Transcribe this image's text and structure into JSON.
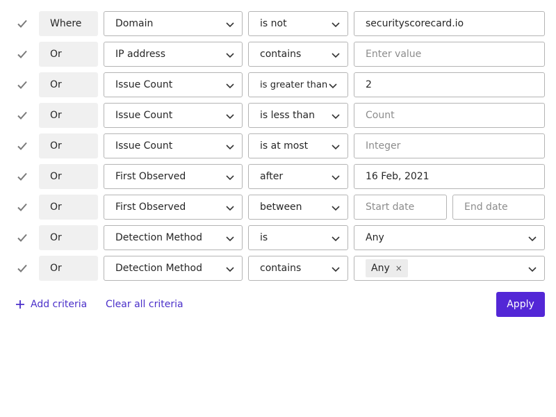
{
  "colors": {
    "accent": "#5327d6",
    "link": "#4a2fc9",
    "check": "#7a7a7a",
    "conjunction_bg": "#f0f0f0",
    "border": "#b4b4b4"
  },
  "criteria": [
    {
      "conjunction": "Where",
      "field": "Domain",
      "operator": "is not",
      "value": "securityscorecard.io",
      "placeholder": ""
    },
    {
      "conjunction": "Or",
      "field": "IP address",
      "operator": "contains",
      "value": "",
      "placeholder": "Enter value"
    },
    {
      "conjunction": "Or",
      "field": "Issue Count",
      "operator": "is greater than",
      "value": "2",
      "placeholder": ""
    },
    {
      "conjunction": "Or",
      "field": "Issue Count",
      "operator": "is less than",
      "value": "",
      "placeholder": "Count"
    },
    {
      "conjunction": "Or",
      "field": "Issue Count",
      "operator": "is at most",
      "value": "",
      "placeholder": "Integer"
    },
    {
      "conjunction": "Or",
      "field": "First Observed",
      "operator": "after",
      "value": "16 Feb, 2021",
      "placeholder": ""
    },
    {
      "conjunction": "Or",
      "field": "First Observed",
      "operator": "between",
      "start_placeholder": "Start date",
      "end_placeholder": "End date"
    },
    {
      "conjunction": "Or",
      "field": "Detection Method",
      "operator": "is",
      "selected": "Any"
    },
    {
      "conjunction": "Or",
      "field": "Detection Method",
      "operator": "contains",
      "chip": "Any",
      "chip_remove": "×"
    }
  ],
  "footer": {
    "add_label": "Add criteria",
    "clear_label": "Clear all criteria",
    "apply_label": "Apply"
  }
}
